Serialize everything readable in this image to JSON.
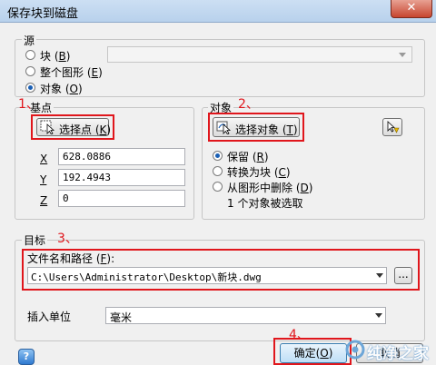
{
  "window": {
    "title": "保存块到磁盘",
    "close_glyph": "✕"
  },
  "source": {
    "legend": "源",
    "options": [
      {
        "label": "块",
        "key": "B",
        "selected": false
      },
      {
        "label": "整个图形",
        "key": "E",
        "selected": false
      },
      {
        "label": "对象",
        "key": "O",
        "selected": true
      }
    ],
    "block_select_value": ""
  },
  "base_point": {
    "legend": "基点",
    "pick_button_label": "选择点",
    "pick_button_key": "K",
    "fields": [
      {
        "label": "X",
        "value": "628.0886"
      },
      {
        "label": "Y",
        "value": "192.4943"
      },
      {
        "label": "Z",
        "value": "0"
      }
    ]
  },
  "objects": {
    "legend": "对象",
    "select_button_label": "选择对象",
    "select_button_key": "T",
    "options": [
      {
        "label": "保留",
        "key": "R",
        "selected": true
      },
      {
        "label": "转换为块",
        "key": "C",
        "selected": false
      },
      {
        "label": "从图形中删除",
        "key": "D",
        "selected": false
      }
    ],
    "status": "1 个对象被选取"
  },
  "target": {
    "legend": "目标",
    "file_label": "文件名和路径",
    "file_key": "F",
    "file_path": "C:\\Users\\Administrator\\Desktop\\新块.dwg",
    "browse_label": "...",
    "units_label": "插入单位",
    "units_value": "毫米"
  },
  "footer": {
    "help_label": "?",
    "ok_label": "确定",
    "ok_key": "O",
    "cancel_label": "取消"
  },
  "annotations": {
    "step1": "1、",
    "step2": "2、",
    "step3": "3、",
    "step4": "4、"
  },
  "watermark": {
    "text": "纯净之家"
  },
  "colors": {
    "annotation_red": "#e0161c",
    "accent_blue": "#1a5fb4"
  }
}
